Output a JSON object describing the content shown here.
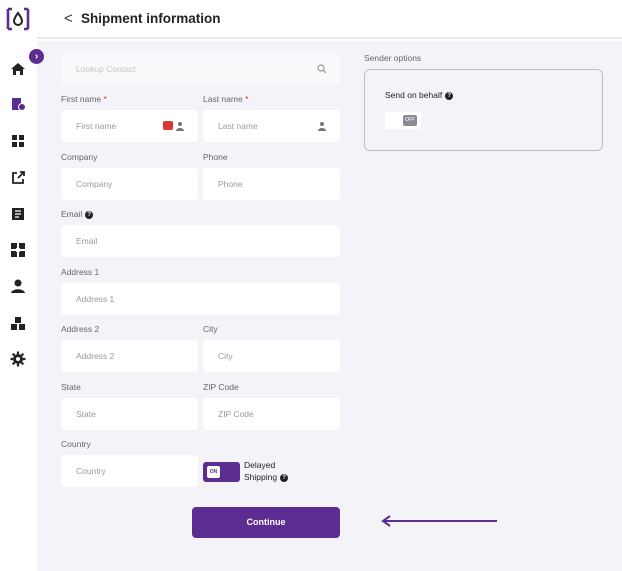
{
  "app": {
    "logo_text": "[o]"
  },
  "header": {
    "back_glyph": "<",
    "title": "Shipment information"
  },
  "sidebar": {
    "collapse_glyph": "›",
    "items": [
      {
        "icon": "home-icon"
      },
      {
        "icon": "shipments-icon"
      },
      {
        "icon": "dashboard-icon"
      },
      {
        "icon": "external-link-icon"
      },
      {
        "icon": "reports-icon"
      },
      {
        "icon": "integrations-icon"
      },
      {
        "icon": "user-icon"
      },
      {
        "icon": "inventory-icon"
      },
      {
        "icon": "settings-icon"
      }
    ]
  },
  "form": {
    "lookup": {
      "placeholder": "Lookup Contact"
    },
    "first_name": {
      "label": "First name",
      "required": "*",
      "placeholder": "First name"
    },
    "last_name": {
      "label": "Last name",
      "required": "*",
      "placeholder": "Last name"
    },
    "company": {
      "label": "Company",
      "placeholder": "Company"
    },
    "phone": {
      "label": "Phone",
      "placeholder": "Phone"
    },
    "email": {
      "label": "Email",
      "placeholder": "Email",
      "help": "?"
    },
    "address1": {
      "label": "Address 1",
      "placeholder": "Address 1"
    },
    "address2": {
      "label": "Address 2",
      "placeholder": "Address 2"
    },
    "city": {
      "label": "City",
      "placeholder": "City"
    },
    "state": {
      "label": "State",
      "placeholder": "State"
    },
    "zip": {
      "label": "ZIP Code",
      "placeholder": "ZIP Code"
    },
    "country": {
      "label": "Country",
      "placeholder": "Country"
    },
    "delayed_shipping": {
      "toggle_text": "ON",
      "label_line1": "Delayed",
      "label_line2": "Shipping",
      "help": "?"
    },
    "continue_label": "Continue"
  },
  "sender_options": {
    "title": "Sender options",
    "send_on_behalf_label": "Send on behalf",
    "help": "?",
    "toggle_text": "OFF"
  },
  "colors": {
    "accent": "#5b2d90",
    "background": "#f4f4f8",
    "required": "#c0392b"
  }
}
